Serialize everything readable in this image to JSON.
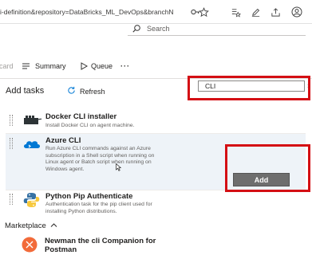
{
  "browser": {
    "url": "i-definition&repository=DataBricks_ML_DevOps&branchN",
    "icons": [
      "keys-icon",
      "star-icon",
      "favorites-bar-icon",
      "pen-icon",
      "share-icon",
      "profile-icon"
    ]
  },
  "header": {
    "search_label": "Search"
  },
  "toolbar": {
    "partial_item": "card",
    "summary_label": "Summary",
    "queue_label": "Queue",
    "more_label": "···"
  },
  "add_tasks": {
    "title": "Add tasks",
    "refresh_label": "Refresh",
    "search_value": "CLI",
    "add_button_label": "Add",
    "tasks": [
      {
        "name": "Docker CLI installer",
        "description": "Install Docker CLI on agent machine."
      },
      {
        "name": "Azure CLI",
        "description_lines": [
          "Run  Azure  CLI  commands  against  an  Azure",
          "subscription  in  a  Shell  script  when  running  on",
          "Linux  agent  or  Batch  script  when  running  on",
          "Windows agent."
        ]
      },
      {
        "name": "Python Pip Authenticate",
        "description_lines": [
          "Authentication  task  for  the  pip  client  used  for",
          "installing Python distributions."
        ]
      }
    ],
    "marketplace_label": "Marketplace",
    "marketplace_items": [
      {
        "name_lines": [
          "Newman the cli Companion for",
          "Postman"
        ]
      }
    ]
  },
  "colors": {
    "highlight_red": "#d40f14",
    "azure_blue": "#0078d4",
    "add_button_gray": "#6e6e6e",
    "selected_row": "#eef3f8"
  }
}
